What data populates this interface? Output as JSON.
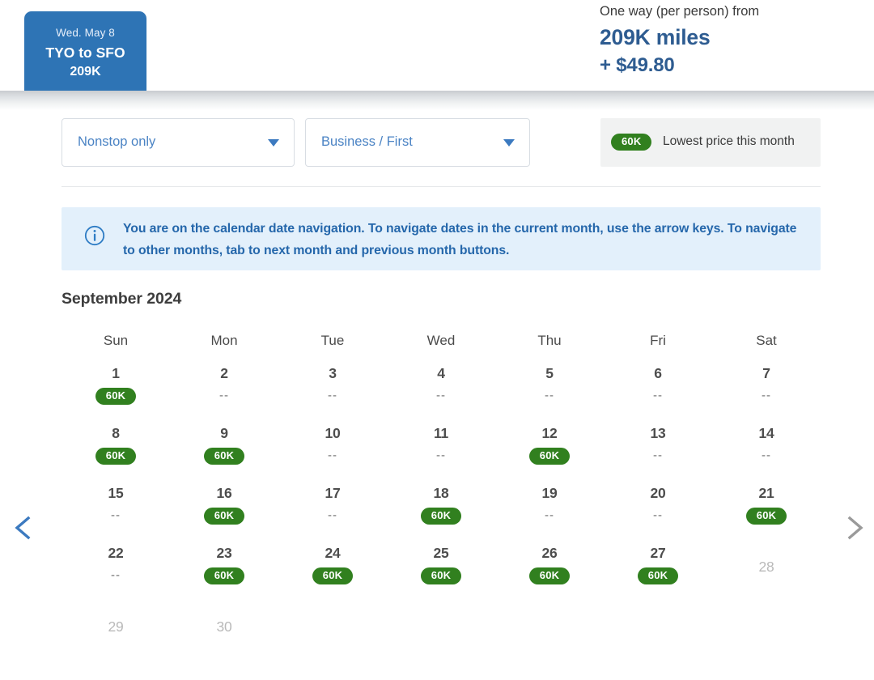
{
  "header": {
    "flight_tab": {
      "date": "Wed. May 8",
      "route": "TYO to SFO",
      "miles": "209K",
      "accent_color": "#2e74b5"
    },
    "price_summary": {
      "label": "One way (per person) from",
      "miles": "209K miles",
      "cash": "+ $49.80",
      "accent_color": "#2e5c91"
    }
  },
  "filters": {
    "stops_select": {
      "value": "Nonstop only",
      "icon": "caret-down-icon"
    },
    "cabin_select": {
      "value": "Business / First",
      "icon": "caret-down-icon"
    },
    "legend": {
      "badge": "60K",
      "text": "Lowest price this month",
      "badge_color": "#31801f",
      "background": "#f1f2f2"
    }
  },
  "info_banner": {
    "icon": "info-circle-icon",
    "text": "You are on the calendar date navigation. To navigate dates in the current month, use the arrow keys. To navigate to other months, tab to next month and previous month buttons.",
    "background": "#e3f0fb",
    "text_color": "#2567ab"
  },
  "calendar": {
    "month_title": "September 2024",
    "day_headers": [
      "Sun",
      "Mon",
      "Tue",
      "Wed",
      "Thu",
      "Fri",
      "Sat"
    ],
    "no_price_marker": "--",
    "weeks": [
      [
        {
          "day": "1",
          "price": "60K",
          "state": "priced"
        },
        {
          "day": "2",
          "price": "--",
          "state": "nodata"
        },
        {
          "day": "3",
          "price": "--",
          "state": "nodata"
        },
        {
          "day": "4",
          "price": "--",
          "state": "nodata"
        },
        {
          "day": "5",
          "price": "--",
          "state": "nodata"
        },
        {
          "day": "6",
          "price": "--",
          "state": "nodata"
        },
        {
          "day": "7",
          "price": "--",
          "state": "nodata"
        }
      ],
      [
        {
          "day": "8",
          "price": "60K",
          "state": "priced"
        },
        {
          "day": "9",
          "price": "60K",
          "state": "priced"
        },
        {
          "day": "10",
          "price": "--",
          "state": "nodata"
        },
        {
          "day": "11",
          "price": "--",
          "state": "nodata"
        },
        {
          "day": "12",
          "price": "60K",
          "state": "priced"
        },
        {
          "day": "13",
          "price": "--",
          "state": "nodata"
        },
        {
          "day": "14",
          "price": "--",
          "state": "nodata"
        }
      ],
      [
        {
          "day": "15",
          "price": "--",
          "state": "nodata"
        },
        {
          "day": "16",
          "price": "60K",
          "state": "priced"
        },
        {
          "day": "17",
          "price": "--",
          "state": "nodata"
        },
        {
          "day": "18",
          "price": "60K",
          "state": "priced"
        },
        {
          "day": "19",
          "price": "--",
          "state": "nodata"
        },
        {
          "day": "20",
          "price": "--",
          "state": "nodata"
        },
        {
          "day": "21",
          "price": "60K",
          "state": "priced"
        }
      ],
      [
        {
          "day": "22",
          "price": "--",
          "state": "nodata"
        },
        {
          "day": "23",
          "price": "60K",
          "state": "priced"
        },
        {
          "day": "24",
          "price": "60K",
          "state": "priced"
        },
        {
          "day": "25",
          "price": "60K",
          "state": "priced"
        },
        {
          "day": "26",
          "price": "60K",
          "state": "priced"
        },
        {
          "day": "27",
          "price": "60K",
          "state": "priced"
        },
        {
          "day": "28",
          "price": "",
          "state": "disabled"
        }
      ],
      [
        {
          "day": "29",
          "price": "",
          "state": "disabled"
        },
        {
          "day": "30",
          "price": "",
          "state": "disabled"
        },
        {
          "day": "",
          "price": "",
          "state": "empty"
        },
        {
          "day": "",
          "price": "",
          "state": "empty"
        },
        {
          "day": "",
          "price": "",
          "state": "empty"
        },
        {
          "day": "",
          "price": "",
          "state": "empty"
        },
        {
          "day": "",
          "price": "",
          "state": "empty"
        }
      ]
    ]
  },
  "navigation": {
    "prev_month": {
      "icon": "chevron-left-icon",
      "color": "#3c7ac0",
      "enabled": true
    },
    "next_month": {
      "icon": "chevron-right-icon",
      "color": "#9a9a9a",
      "enabled": false
    }
  }
}
